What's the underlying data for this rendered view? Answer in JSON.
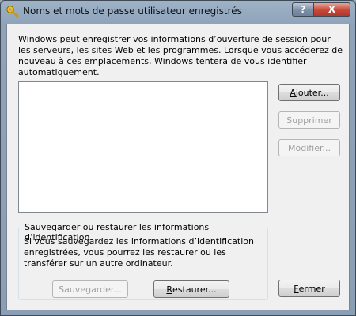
{
  "window": {
    "title": "Noms et mots de passe utilisateur enregistrés",
    "help_label": "?",
    "close_label": "X"
  },
  "main": {
    "description": "Windows peut enregistrer vos informations d’ouverture de session pour les serveurs, les sites Web et les programmes. Lorsque vous accéderez de nouveau à ces emplacements, Windows tentera de vous identifier automatiquement."
  },
  "buttons": {
    "add": {
      "mnemonic": "A",
      "rest": "jouter..."
    },
    "remove": {
      "label": "Supprimer"
    },
    "modify": {
      "label": "Modifier..."
    },
    "backup": {
      "label": "Sauvegarder..."
    },
    "restore": {
      "mnemonic": "R",
      "rest": "estaurer..."
    },
    "close": {
      "mnemonic": "F",
      "rest": "ermer"
    }
  },
  "backup_group": {
    "legend": "Sauvegarder ou restaurer les informations d’identification",
    "text": "Si vous sauvegardez les informations d’identification enregistrées, vous pourrez les restaurer ou les transférer sur un autre ordinateur."
  }
}
